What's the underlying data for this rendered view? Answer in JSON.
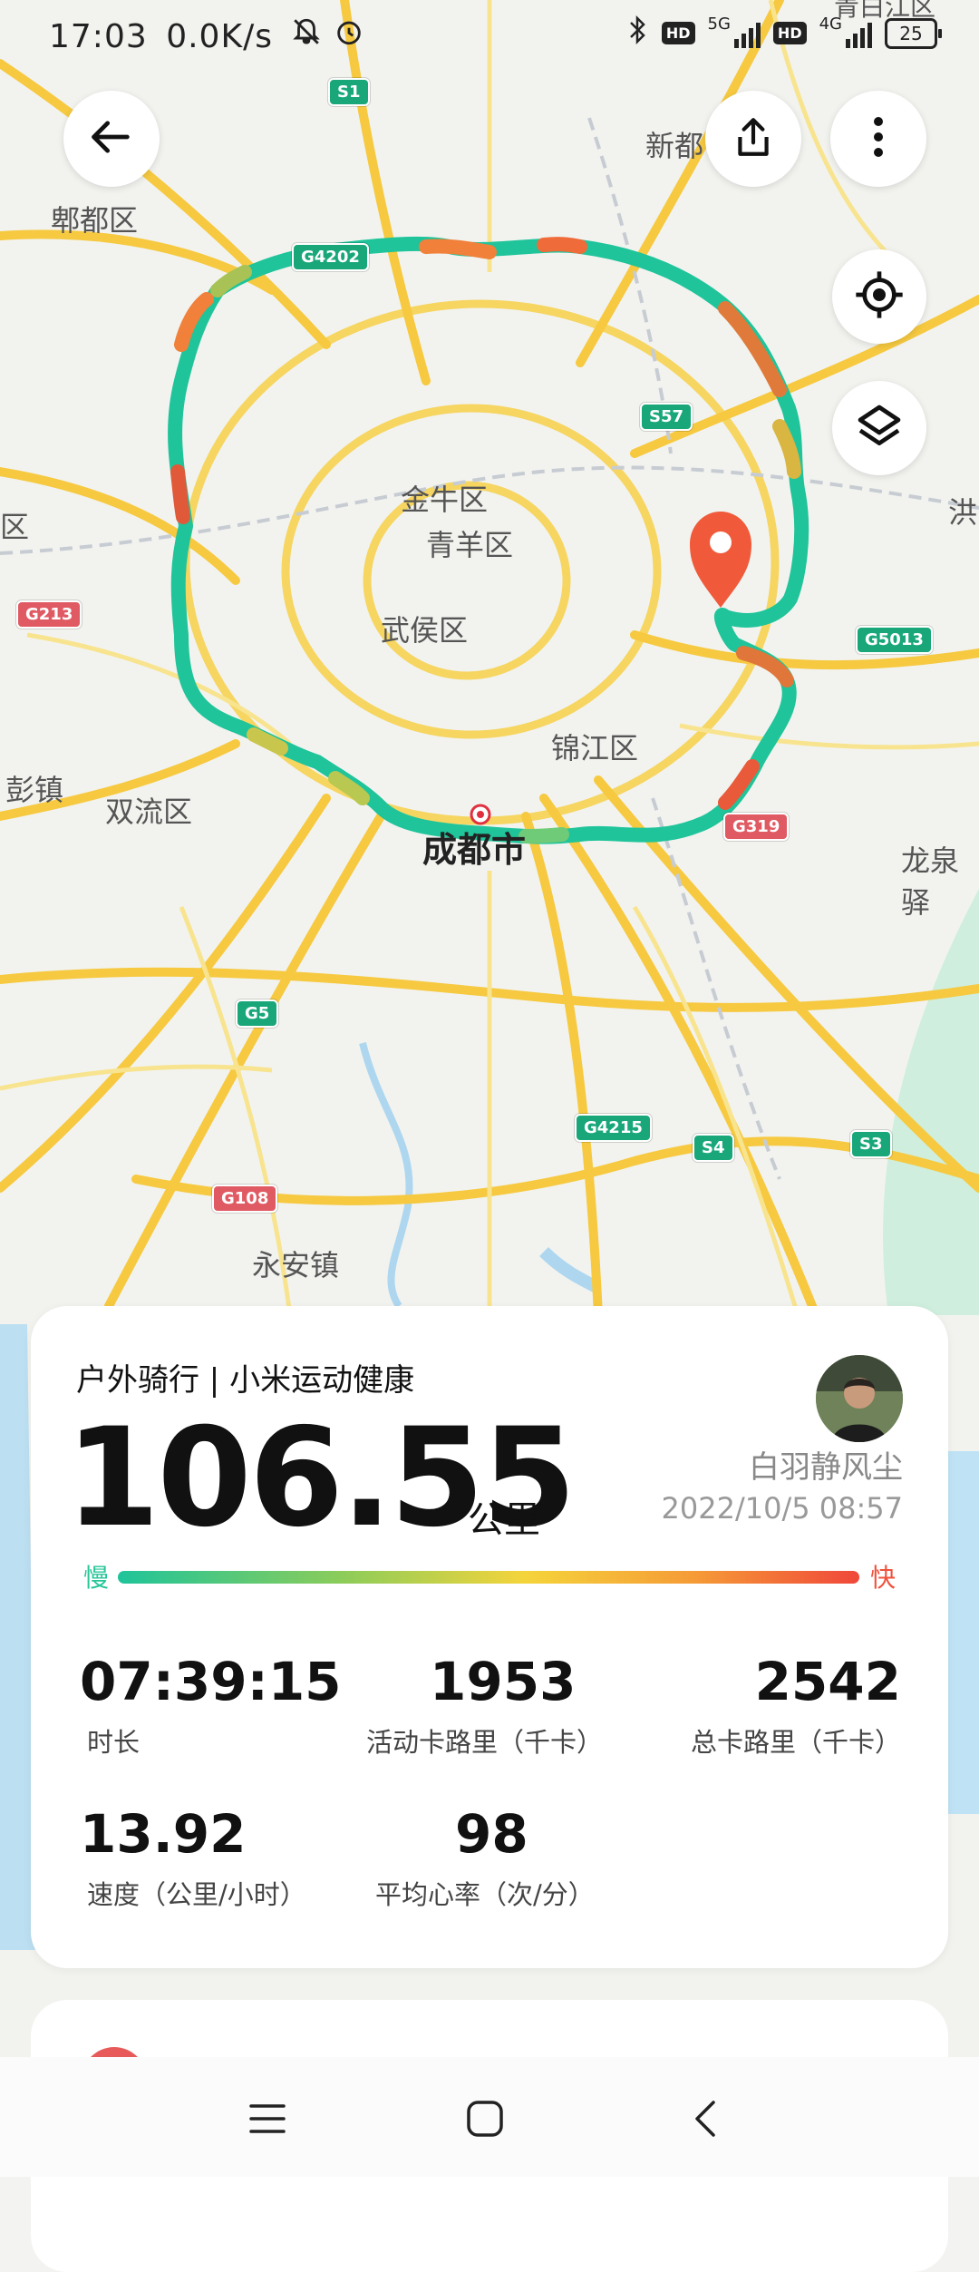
{
  "status_bar": {
    "time": "17:03",
    "net_speed": "0.0K/s",
    "signal1": "5G",
    "signal2": "4G",
    "battery": "25"
  },
  "map": {
    "labels": {
      "pidu": "郫都区",
      "xindu": "新都",
      "jinniu": "金牛区",
      "qingyang": "青羊区",
      "wuhou": "武侯区",
      "jinjiang": "锦江区",
      "chengdu": "成都市",
      "shuangliu": "双流区",
      "pengzhen": "彭镇",
      "longquan": "龙泉驿",
      "yongan": "永安镇",
      "left_edge": "区",
      "hong": "洪",
      "qingbaijiang": "青白江区"
    },
    "shields": {
      "s1": "S1",
      "g4202": "G4202",
      "s57": "S57",
      "g213": "G213",
      "g5013": "G5013",
      "g319": "G319",
      "g5": "G5",
      "g4215": "G4215",
      "s4": "S4",
      "s3": "S3",
      "g108": "G108"
    }
  },
  "summary": {
    "activity": "户外骑行 | 小米运动健康",
    "distance": "106.55",
    "unit": "公里",
    "user": "白羽静风尘",
    "datetime": "2022/10/5 08:57",
    "slow_label": "慢",
    "fast_label": "快",
    "stats": [
      {
        "value": "07:39:15",
        "label": "时长"
      },
      {
        "value": "1953",
        "label": "活动卡路里（千卡）"
      },
      {
        "value": "2542",
        "label": "总卡路里（千卡）"
      },
      {
        "value": "13.92",
        "label": "速度（公里/小时）"
      },
      {
        "value": "98",
        "label": "平均心率（次/分）"
      }
    ]
  },
  "colors": {
    "route_fast": "#f0473a",
    "route_slow": "#1fc49a",
    "pin": "#f05a3a"
  },
  "icons": [
    "back-icon",
    "share-icon",
    "more-icon",
    "locate-icon",
    "layers-icon",
    "menu-icon",
    "home-icon",
    "back-nav-icon"
  ]
}
